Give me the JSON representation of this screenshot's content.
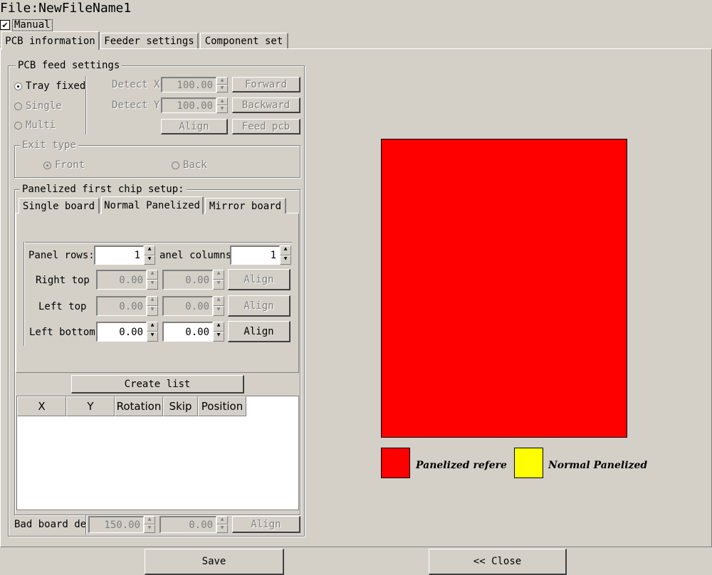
{
  "header": {
    "file_title": "File:NewFileName1",
    "manual_label": "Manual",
    "manual_checked": true
  },
  "tabs": [
    {
      "label": "PCB information",
      "active": true
    },
    {
      "label": "Feeder settings",
      "active": false
    },
    {
      "label": "Component set",
      "active": false
    }
  ],
  "pcb_feed": {
    "title": "PCB feed settings",
    "mode_tray": "Tray fixed",
    "mode_single": "Single",
    "mode_multi": "Multi",
    "detect_x_label": "Detect X",
    "detect_x_value": "100.00",
    "detect_y_label": "Detect Y",
    "detect_y_value": "100.00",
    "forward_label": "Forward",
    "backward_label": "Backward",
    "align_label": "Align",
    "feed_pcb_label": "Feed pcb"
  },
  "exit_type": {
    "title": "Exit type",
    "front_label": "Front",
    "back_label": "Back"
  },
  "panelized": {
    "title": "Panelized first chip setup:",
    "subtabs": [
      {
        "label": "Single board",
        "active": false
      },
      {
        "label": "Normal Panelized",
        "active": true
      },
      {
        "label": "Mirror board",
        "active": false
      }
    ],
    "panel_rows_label": "Panel rows:",
    "panel_rows_value": "1",
    "panel_columns_label": "anel columns",
    "panel_columns_value": "1",
    "right_top_label": "Right top",
    "right_top_x": "0.00",
    "right_top_y": "0.00",
    "left_top_label": "Left top",
    "left_top_x": "0.00",
    "left_top_y": "0.00",
    "left_bottom_label": "Left bottom",
    "left_bottom_x": "0.00",
    "left_bottom_y": "0.00",
    "align_label": "Align"
  },
  "create_list_label": "Create list",
  "table": {
    "columns": [
      "X",
      "Y",
      "Rotation",
      "Skip",
      "Position"
    ],
    "rows": []
  },
  "bad_board": {
    "label": "Bad board de",
    "x_value": "150.00",
    "y_value": "0.00",
    "align_label": "Align"
  },
  "preview": {
    "board_color": "#ff0000",
    "legend": [
      {
        "color": "#ff0000",
        "label": "Panelized refere"
      },
      {
        "color": "#ffff00",
        "label": "Normal Panelized"
      }
    ]
  },
  "footer": {
    "save_label": "Save",
    "close_label": "<< Close"
  }
}
